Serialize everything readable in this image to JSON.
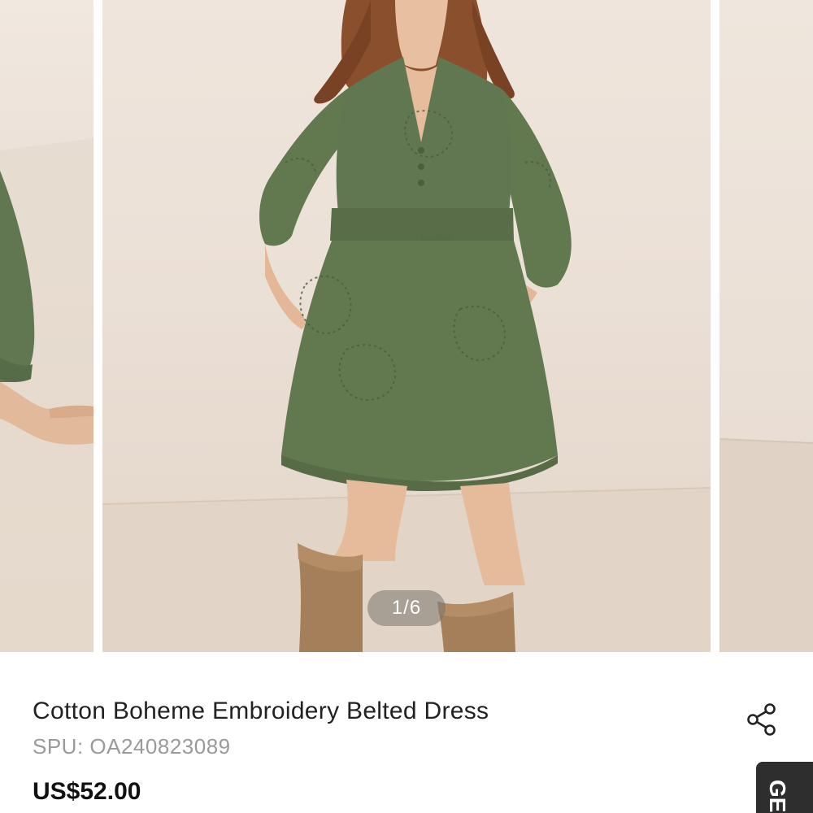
{
  "carousel": {
    "indicator": "1/6",
    "slides": [
      {
        "role": "previous",
        "icon": "product-photo"
      },
      {
        "role": "current",
        "icon": "product-photo"
      },
      {
        "role": "next",
        "icon": "product-photo"
      }
    ]
  },
  "product": {
    "title": "Cotton Boheme Embroidery Belted Dress",
    "spu": "SPU: OA240823089",
    "price": "US$52.00"
  },
  "actions": {
    "share_icon": "share-icon"
  },
  "side_tab": {
    "label": "GE"
  },
  "colors": {
    "dress_green": "#5f7550",
    "boots_tan": "#a57f5a",
    "background_beige": "#ebe0d6",
    "text_dark": "#222222",
    "text_muted": "#9a9a9a"
  }
}
